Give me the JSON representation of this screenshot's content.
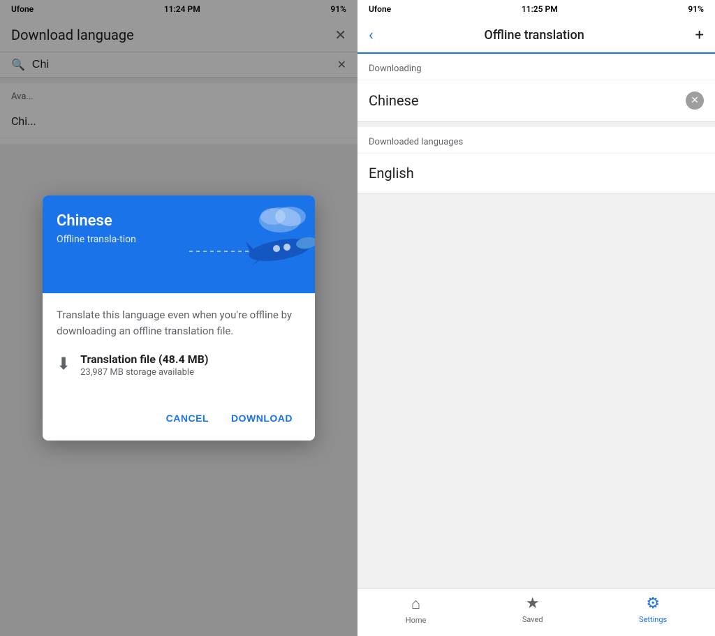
{
  "left": {
    "status_bar": {
      "carrier": "Ufone",
      "time": "11:24 PM",
      "battery": "91%"
    },
    "header": {
      "title": "Download language",
      "close_label": "✕"
    },
    "search": {
      "query": "Chi",
      "placeholder": "Search",
      "clear_label": "✕"
    },
    "list": {
      "section_label": "Ava...",
      "items": [
        "Chi..."
      ]
    },
    "dialog": {
      "header_title": "Chinese",
      "header_subtitle": "Offline transla-tion",
      "description": "Translate this language even when you're offline by downloading an offline translation file.",
      "file_name": "Translation file (48.4 MB)",
      "storage": "23,987 MB storage available",
      "cancel_label": "CANCEL",
      "download_label": "DOWNLOAD"
    }
  },
  "right": {
    "status_bar": {
      "carrier": "Ufone",
      "time": "11:25 PM",
      "battery": "91%"
    },
    "header": {
      "title": "Offline translation",
      "back_label": "‹",
      "add_label": "+"
    },
    "downloading_section": {
      "label": "Downloading",
      "item": "Chinese"
    },
    "downloaded_section": {
      "label": "Downloaded languages",
      "item": "English"
    },
    "nav": {
      "items": [
        {
          "label": "Home",
          "icon": "⌂",
          "active": false
        },
        {
          "label": "Saved",
          "icon": "★",
          "active": false
        },
        {
          "label": "Settings",
          "icon": "⚙",
          "active": true
        }
      ]
    }
  }
}
